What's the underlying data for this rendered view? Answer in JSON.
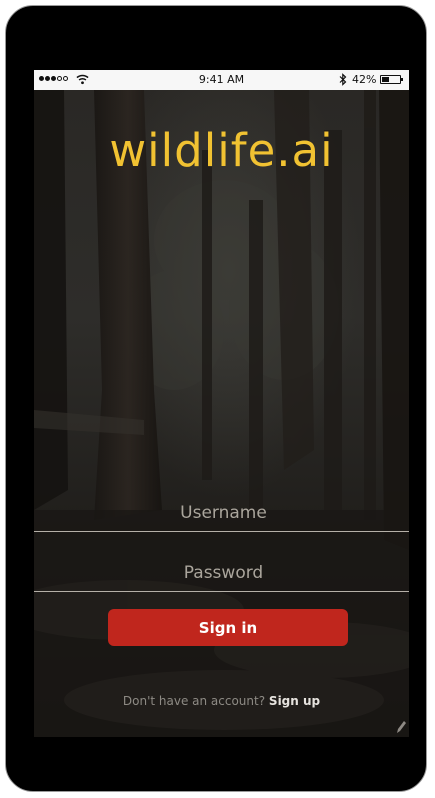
{
  "status_bar": {
    "time": "9:41 AM",
    "battery_text": "42%",
    "battery_level": 0.42,
    "signal_bars_filled": 3,
    "signal_bars_total": 5
  },
  "app": {
    "logo_text": "wildlife.ai",
    "logo_color": "#f1c232"
  },
  "login_form": {
    "username_placeholder": "Username",
    "username_value": "",
    "password_placeholder": "Password",
    "password_value": "",
    "signin_label": "Sign in",
    "signin_color": "#c0261d"
  },
  "footer": {
    "prompt_text": "Don't have an account?",
    "signup_label": "Sign up"
  },
  "icons": {
    "signal": "signal-dots-icon",
    "wifi": "wifi-icon",
    "bluetooth": "bluetooth-icon",
    "battery": "battery-icon",
    "corner": "pencil-icon"
  }
}
